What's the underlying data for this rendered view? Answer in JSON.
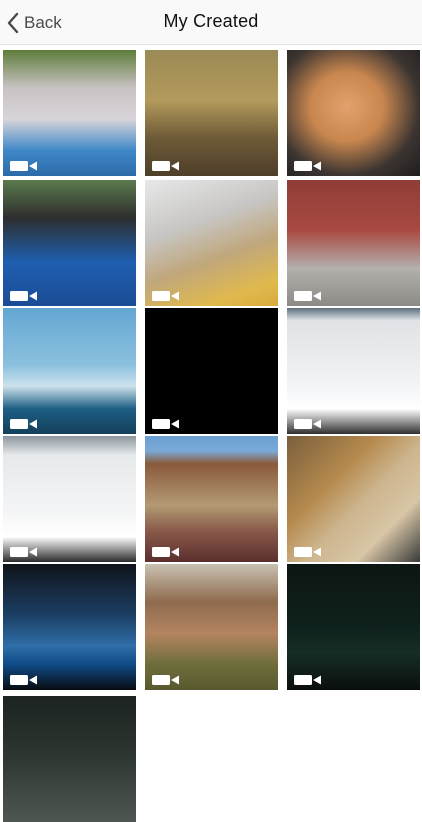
{
  "nav": {
    "back_label": "Back",
    "title": "My Created"
  },
  "grid": {
    "items": [
      {
        "bg": "linear-gradient(180deg,#5d7d3a 0%,#c9c2c3 30%,#d8d4da 55%,#3f88c8 80%,#2c6aa8 100%)"
      },
      {
        "bg": "linear-gradient(180deg,#9a8a55 0%,#b39a5c 40%,#6d5a37 70%,#4e3f2a 100%)"
      },
      {
        "bg": "radial-gradient(ellipse at 45% 45%,#e2a06c 0%,#c9874f 35%,#3b3431 70%,#1f1d1c 100%)"
      },
      {
        "bg": "linear-gradient(180deg,#5b7a4d 0%,#2e2e2e 30%,#1f5fb0 65%,#1a4c94 100%)"
      },
      {
        "bg": "linear-gradient(160deg,#e8e8e8 0%,#c7c6c4 35%,#c0a77c 60%,#e0b94d 85%,#d9a93c 100%)"
      },
      {
        "bg": "linear-gradient(180deg,#8f3d37 0%,#a94a42 40%,#b3b0ad 70%,#8e8a86 100%)"
      },
      {
        "bg": "linear-gradient(180deg,#64a7d4 0%,#8bc0de 45%,#cce2ec 62%,#1d5f84 80%,#143f5a 100%)"
      },
      {
        "bg": "#000000"
      },
      {
        "bg": "linear-gradient(180deg,#5d6f7c 0%,#dfe3e6 10%,#f1f3f5 60%,#ffffff 80%,#2f2f2f 100%)"
      },
      {
        "bg": "linear-gradient(180deg,#8a959b 0%,#e6e9eb 15%,#f4f5f6 60%,#ffffff 80%,#2b2b2b 100%)"
      },
      {
        "bg": "linear-gradient(180deg,#6a9ed2 0%,#7aa9d6 12%,#8a5a3a 22%,#b39a73 55%,#8a5a4a 75%,#5b2f2f 100%)"
      },
      {
        "bg": "linear-gradient(135deg,#7a5f3b 0%,#b68a4f 35%,#cdb58e 55%,#d8c6a6 75%,#3a3a3a 100%)"
      },
      {
        "bg": "linear-gradient(180deg,#10131a 0%,#1b3e63 40%,#2f6ea8 65%,#0f4b86 80%,#080a10 100%)"
      },
      {
        "bg": "linear-gradient(180deg,#c9c1b1 0%,#8e6b4e 30%,#b48460 55%,#6d6d3c 80%,#59592f 100%)"
      },
      {
        "bg": "linear-gradient(180deg,#0c1512 0%,#0f211c 50%,#162d26 70%,#0a0f0d 100%)"
      },
      {
        "bg": "linear-gradient(180deg,#1c2320 0%,#2e3732 50%,#4f5752 100%)"
      }
    ]
  },
  "badge_icon": "video-camera-icon"
}
